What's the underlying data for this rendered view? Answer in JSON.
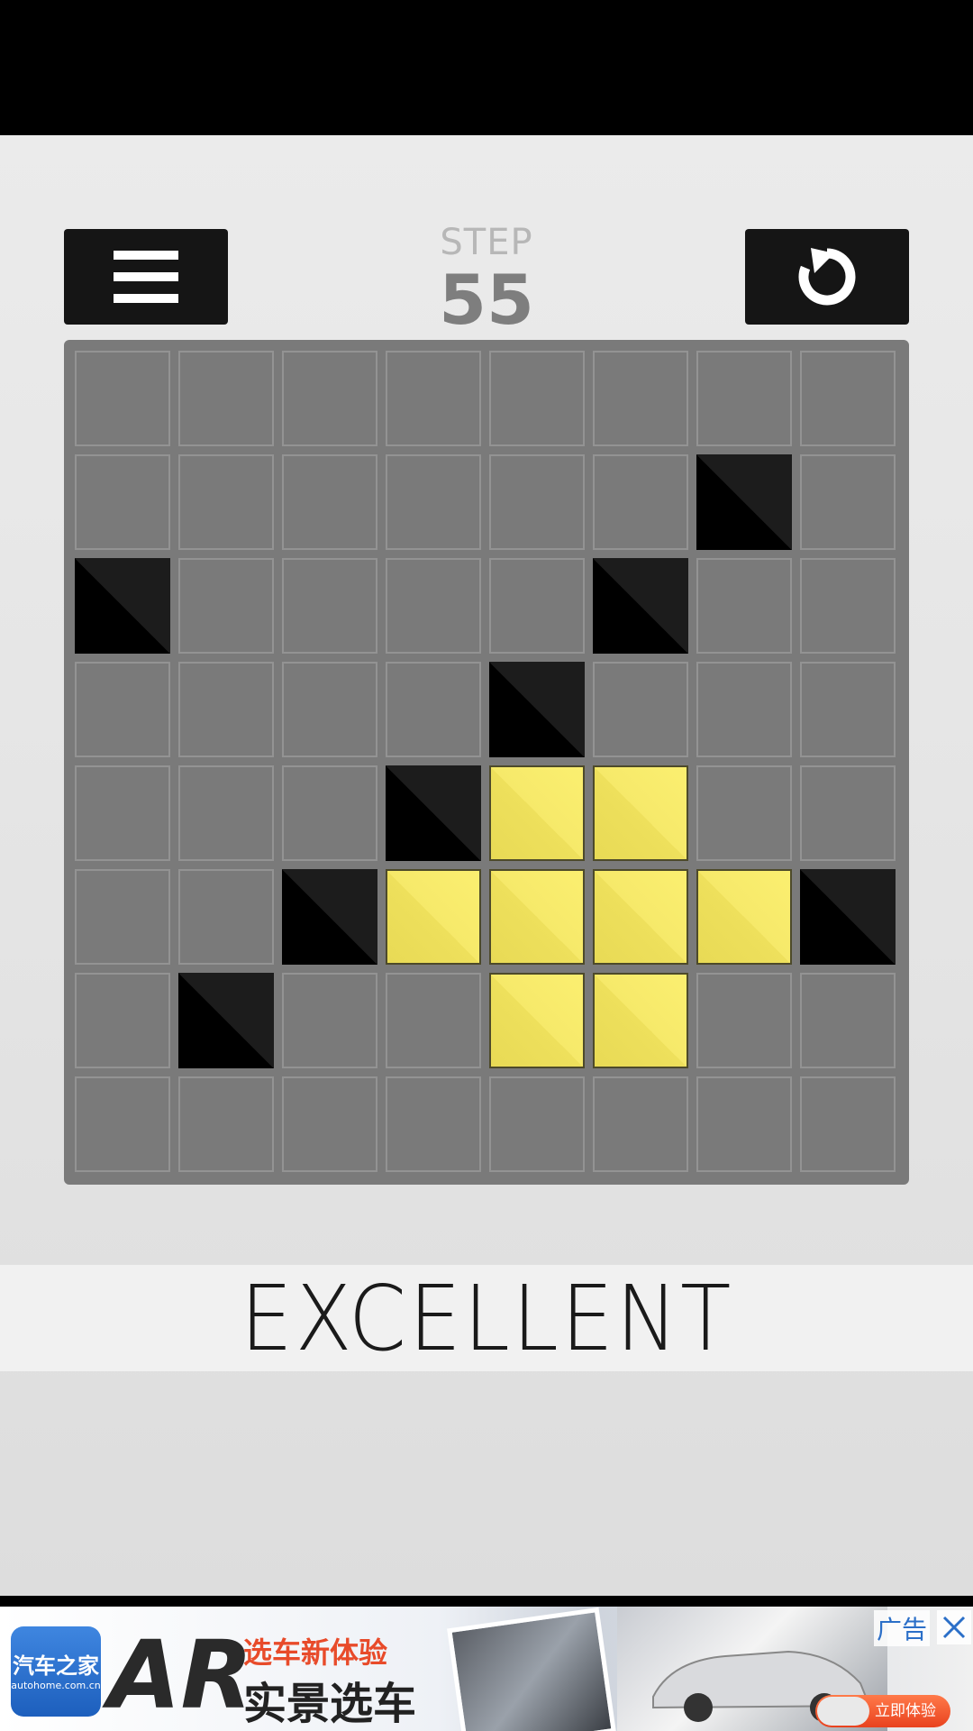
{
  "hud": {
    "step_label": "STEP",
    "step_value": "55",
    "menu_icon": "hamburger-menu-icon",
    "restart_icon": "restart-arrow-icon"
  },
  "board": {
    "rows": 8,
    "cols": 8,
    "cells": [
      [
        "empty",
        "empty",
        "empty",
        "empty",
        "empty",
        "empty",
        "empty",
        "empty"
      ],
      [
        "empty",
        "empty",
        "empty",
        "empty",
        "empty",
        "empty",
        "black",
        "empty"
      ],
      [
        "black",
        "empty",
        "empty",
        "empty",
        "empty",
        "black",
        "empty",
        "empty"
      ],
      [
        "empty",
        "empty",
        "empty",
        "empty",
        "black",
        "empty",
        "empty",
        "empty"
      ],
      [
        "empty",
        "empty",
        "empty",
        "black",
        "yellow",
        "yellow",
        "empty",
        "empty"
      ],
      [
        "empty",
        "empty",
        "black",
        "yellow",
        "yellow",
        "yellow",
        "yellow",
        "black"
      ],
      [
        "empty",
        "black",
        "empty",
        "empty",
        "yellow",
        "yellow",
        "empty",
        "empty"
      ],
      [
        "empty",
        "empty",
        "empty",
        "empty",
        "empty",
        "empty",
        "empty",
        "empty"
      ]
    ],
    "colors": {
      "board": "#7a7a7a",
      "empty_border": "#939393",
      "black": "#000000",
      "yellow": "#f4e664"
    }
  },
  "message": {
    "text": "EXCELLENT"
  },
  "ad": {
    "logo_brand": "汽车之家",
    "logo_domain": "autohome.com.cn",
    "ar_mark": "AR",
    "tagline": "选车新体验",
    "headline": "实景选车",
    "cta": "立即体验",
    "ad_label": "广告",
    "close_icon": "close-icon"
  }
}
